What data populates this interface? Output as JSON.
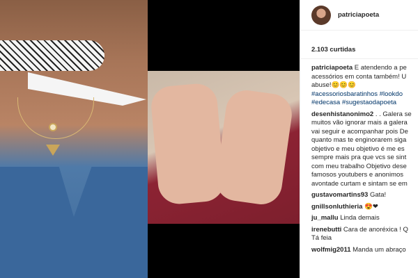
{
  "post": {
    "username": "patriciapoeta",
    "likes": "2.103 curtidas"
  },
  "caption": {
    "user": "patriciapoeta",
    "lines": [
      "E atendendo a pe",
      "acessórios em conta também! U",
      "abuse!😊😊😊"
    ],
    "hashtag_lines": [
      "#acessoriosbaratinhos #lookdo",
      "#edecasa #sugestaodapoeta"
    ]
  },
  "comments": [
    {
      "user": "desenhistanonimo2",
      "lines": [
        ". . Galera se",
        "muitos vão ignorar mais a galera",
        "vai seguir e acompanhar pois De",
        "quanto mas te enginorarem siga",
        "objetivo e meu objetivo é me es",
        "sempre mais pra que vcs se sint",
        "com meu trabalho Objetivo dese",
        "famosos youtubers e anonimos",
        "avontade curtam e sintam se em"
      ]
    },
    {
      "user": "gustavomartins93",
      "lines": [
        "Gata!"
      ]
    },
    {
      "user": "gnillsonluthieria",
      "lines": [
        "😍❤"
      ]
    },
    {
      "user": "ju_mallu",
      "lines": [
        "Linda demais"
      ]
    },
    {
      "user": "irenebutti",
      "lines": [
        "Cara de anoréxica ! Q",
        "Tá feia"
      ]
    },
    {
      "user": "wolfmig2011",
      "lines": [
        "Manda um abraço"
      ]
    }
  ]
}
